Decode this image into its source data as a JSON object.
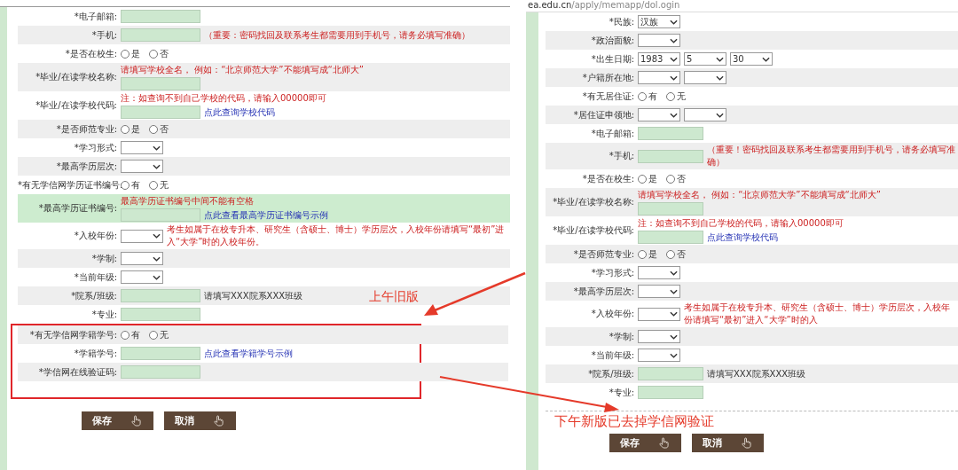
{
  "old_version": {
    "label": "上午旧版",
    "rows": [
      {
        "label": "*电子邮箱:",
        "kind": "text",
        "highlighted": false
      },
      {
        "label": "*手机:",
        "kind": "text",
        "hint_after": "（重要：密码找回及联系考生都需要用到手机号，请务必填写准确）",
        "highlighted": false
      },
      {
        "label": "*是否在校生:",
        "kind": "radio",
        "options": [
          {
            "label": "是",
            "selected": false
          },
          {
            "label": "否",
            "selected": false
          }
        ],
        "highlighted": false
      },
      {
        "label": "*毕业/在读学校名称:",
        "kind": "text",
        "hint_above": "请填写学校全名， 例如：“北京师范大学”不能填写成“北师大”",
        "highlighted": false
      },
      {
        "label": "*毕业/在读学校代码:",
        "kind": "text",
        "hint_above": "注：如查询不到自己学校的代码，请输入00000即可",
        "link": "点此查询学校代码",
        "highlighted": false
      },
      {
        "label": "*是否师范专业:",
        "kind": "radio",
        "options": [
          {
            "label": "是",
            "selected": false
          },
          {
            "label": "否",
            "selected": false
          }
        ],
        "highlighted": false
      },
      {
        "label": "*学习形式:",
        "kind": "select",
        "highlighted": false
      },
      {
        "label": "*最高学历层次:",
        "kind": "select",
        "highlighted": false
      },
      {
        "label": "*有无学信网学历证书编号:",
        "kind": "radio",
        "options": [
          {
            "label": "有",
            "selected": false
          },
          {
            "label": "无",
            "selected": false
          }
        ],
        "highlighted": false
      },
      {
        "label": "*最高学历证书编号:",
        "kind": "text",
        "hint_above": "最高学历证书编号中间不能有空格",
        "link": "点此查看最高学历证书编号示例",
        "highlighted": true
      },
      {
        "label": "*入校年份:",
        "kind": "select",
        "hint_after": "考生如属于在校专升本、研究生（含硕士、博士）学历层次，入校年份请填写“最初”进入“大学”时的入校年份。",
        "highlighted": false
      },
      {
        "label": "*学制:",
        "kind": "select",
        "highlighted": false
      },
      {
        "label": "*当前年级:",
        "kind": "select",
        "highlighted": false
      },
      {
        "label": "*院系/班级:",
        "kind": "text",
        "note_after": "请填写XXX院系XXX班级",
        "highlighted": false
      },
      {
        "label": "*专业:",
        "kind": "text",
        "highlighted": false
      }
    ],
    "removed_rows": [
      {
        "label": "*有无学信网学籍学号:",
        "kind": "radio",
        "options": [
          {
            "label": "有",
            "selected": false
          },
          {
            "label": "无",
            "selected": false
          }
        ],
        "highlighted": false
      },
      {
        "label": "*学籍学号:",
        "kind": "text",
        "link": "点此查看学籍学号示例",
        "highlighted": false
      },
      {
        "label": "*学信网在线验证码:",
        "kind": "text",
        "highlighted": false
      }
    ],
    "buttons": [
      "保存",
      "取消"
    ]
  },
  "new_version": {
    "url_host": "ea.edu.cn",
    "url_path": "/apply/memapp/dol.ogin",
    "label": "下午新版已去掉学信网验证",
    "rows": [
      {
        "label": "*民族:",
        "kind": "select",
        "value": "汉族",
        "highlighted": false
      },
      {
        "label": "*政治面貌:",
        "kind": "select",
        "highlighted": false
      },
      {
        "label": "*出生日期:",
        "kind": "date",
        "values": [
          "1983",
          "5",
          "30"
        ],
        "highlighted": false
      },
      {
        "label": "*户籍所在地:",
        "kind": "select_pair",
        "highlighted": false
      },
      {
        "label": "*有无居住证:",
        "kind": "radio",
        "options": [
          {
            "label": "有",
            "selected": false
          },
          {
            "label": "无",
            "selected": false
          }
        ],
        "highlighted": false
      },
      {
        "label": "*居住证申领地:",
        "kind": "select_pair",
        "highlighted": false
      },
      {
        "label": "*电子邮箱:",
        "kind": "text",
        "highlighted": false
      },
      {
        "label": "*手机:",
        "kind": "text",
        "hint_after": "（重要！密码找回及联系考生都需要用到手机号，请务必填写准确）",
        "highlighted": false
      },
      {
        "label": "*是否在校生:",
        "kind": "radio",
        "options": [
          {
            "label": "是",
            "selected": false
          },
          {
            "label": "否",
            "selected": false
          }
        ],
        "highlighted": false
      },
      {
        "label": "*毕业/在读学校名称:",
        "kind": "text",
        "hint_above": "请填写学校全名， 例如：“北京师范大学”不能填写成“北师大”",
        "highlighted": false
      },
      {
        "label": "*毕业/在读学校代码:",
        "kind": "text",
        "hint_above": "注：如查询不到自己学校的代码，请输入00000即可",
        "link": "点此查询学校代码",
        "highlighted": false
      },
      {
        "label": "*是否师范专业:",
        "kind": "radio",
        "options": [
          {
            "label": "是",
            "selected": false
          },
          {
            "label": "否",
            "selected": false
          }
        ],
        "highlighted": false
      },
      {
        "label": "*学习形式:",
        "kind": "select",
        "highlighted": false
      },
      {
        "label": "*最高学历层次:",
        "kind": "select",
        "highlighted": false
      },
      {
        "label": "*入校年份:",
        "kind": "select",
        "hint_after": "考生如属于在校专升本、研究生（含硕士、博士）学历层次，入校年份请填写“最初”进入“大学”时的入",
        "highlighted": false
      },
      {
        "label": "*学制:",
        "kind": "select",
        "highlighted": false
      },
      {
        "label": "*当前年级:",
        "kind": "select",
        "highlighted": false
      },
      {
        "label": "*院系/班级:",
        "kind": "text",
        "note_after": "请填写XXX院系XXX班级",
        "highlighted": false
      },
      {
        "label": "*专业:",
        "kind": "text",
        "highlighted": false
      }
    ],
    "buttons": [
      "保存",
      "取消"
    ]
  }
}
